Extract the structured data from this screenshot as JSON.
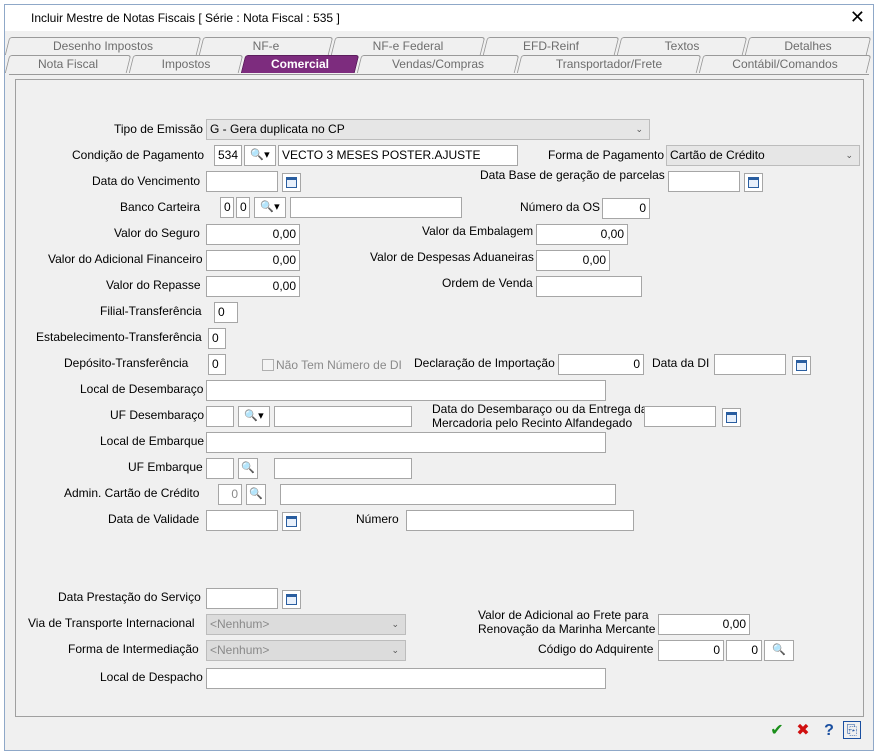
{
  "window": {
    "title": "Incluir Mestre de Notas Fiscais [ Série :     Nota Fiscal : 535 ]",
    "close_glyph": "✕"
  },
  "tabs_back": [
    {
      "label": "Desenho Impostos"
    },
    {
      "label": "NF-e"
    },
    {
      "label": "NF-e Federal"
    },
    {
      "label": "EFD-Reinf"
    },
    {
      "label": "Textos"
    },
    {
      "label": "Detalhes"
    }
  ],
  "tabs_front": [
    {
      "label": "Nota Fiscal"
    },
    {
      "label": "Impostos"
    },
    {
      "label": "Comercial",
      "active": true
    },
    {
      "label": "Vendas/Compras"
    },
    {
      "label": "Transportador/Frete"
    },
    {
      "label": "Contábil/Comandos"
    }
  ],
  "form": {
    "tipo_emissao": {
      "label": "Tipo de Emissão",
      "value": "G - Gera duplicata no CP"
    },
    "condicao_pagamento": {
      "label": "Condição de Pagamento",
      "code": "534",
      "description": "VECTO 3 MESES POSTER.AJUSTE"
    },
    "forma_pagamento": {
      "label": "Forma de Pagamento",
      "value": "Cartão de Crédito"
    },
    "data_vencimento": {
      "label": "Data do Vencimento",
      "value": ""
    },
    "data_base_parcelas": {
      "label": "Data Base de geração de parcelas",
      "value": ""
    },
    "banco_carteira": {
      "label": "Banco Carteira",
      "bank": "0",
      "carteira": "0",
      "description": ""
    },
    "numero_os": {
      "label": "Número da OS",
      "value": "0"
    },
    "valor_seguro": {
      "label": "Valor do Seguro",
      "value": "0,00"
    },
    "valor_embalagem": {
      "label": "Valor da Embalagem",
      "value": "0,00"
    },
    "valor_adicional_financeiro": {
      "label": "Valor do Adicional Financeiro",
      "value": "0,00"
    },
    "valor_despesas_aduaneiras": {
      "label": "Valor de Despesas Aduaneiras",
      "value": "0,00"
    },
    "valor_repasse": {
      "label": "Valor do Repasse",
      "value": "0,00"
    },
    "ordem_venda": {
      "label": "Ordem de Venda",
      "value": ""
    },
    "filial_transferencia": {
      "label": "Filial-Transferência",
      "value": "0"
    },
    "estabelecimento_transferencia": {
      "label": "Estabelecimento-Transferência",
      "value": "0"
    },
    "deposito_transferencia": {
      "label": "Depósito-Transferência",
      "value": "0"
    },
    "nao_tem_di": {
      "label": "Não Tem Número de DI"
    },
    "declaracao_importacao": {
      "label": "Declaração de Importação",
      "value": "0"
    },
    "data_di": {
      "label": "Data da DI",
      "value": ""
    },
    "local_desembaraco": {
      "label": "Local de Desembaraço",
      "value": ""
    },
    "uf_desembaraco": {
      "label": "UF Desembaraço",
      "value": "",
      "description": ""
    },
    "data_desembaraco": {
      "label_line1": "Data do Desembaraço ou da Entrega da",
      "label_line2": "Mercadoria pelo Recinto Alfandegado",
      "value": ""
    },
    "local_embarque": {
      "label": "Local de Embarque",
      "value": ""
    },
    "uf_embarque": {
      "label": "UF Embarque",
      "value": "",
      "description": ""
    },
    "admin_cartao": {
      "label": "Admin. Cartão de Crédito",
      "value": "0",
      "description": ""
    },
    "data_validade": {
      "label": "Data de Validade",
      "value": ""
    },
    "numero": {
      "label": "Número",
      "value": ""
    },
    "data_prestacao": {
      "label": "Data Prestação do Serviço",
      "value": ""
    },
    "via_transporte": {
      "label": "Via de Transporte Internacional",
      "value": "<Nenhum>"
    },
    "valor_adicional_frete": {
      "label_line1": "Valor de Adicional ao Frete para",
      "label_line2": "Renovação da Marinha Mercante",
      "value": "0,00"
    },
    "forma_intermediacao": {
      "label": "Forma de Intermediação",
      "value": "<Nenhum>"
    },
    "codigo_adquirente": {
      "label": "Código do Adquirente",
      "value1": "0",
      "value2": "0"
    },
    "local_despacho": {
      "label": "Local de Despacho",
      "value": ""
    }
  },
  "footer": {
    "ok_glyph": "✔",
    "cancel_glyph": "✖",
    "help_glyph": "?",
    "save_glyph": "⎘"
  },
  "colors": {
    "active_tab": "#7d2c7e",
    "ok": "#1a8f1a",
    "cancel": "#d01010",
    "help": "#1a4fa0"
  }
}
